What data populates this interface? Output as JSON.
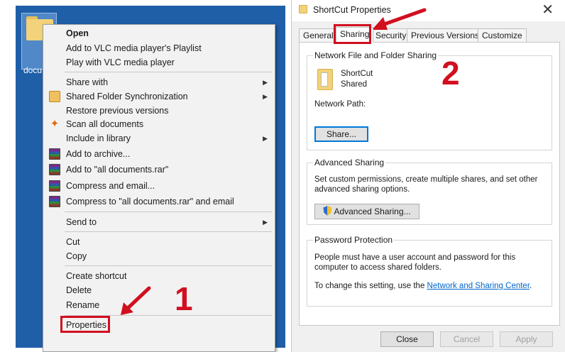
{
  "desktop": {
    "icon_label": "docu"
  },
  "context_menu": {
    "items": [
      {
        "label": "Open",
        "bold": true
      },
      {
        "label": "Add to VLC media player's Playlist"
      },
      {
        "label": "Play with VLC media player"
      },
      {
        "label": "Share with",
        "submenu": true
      },
      {
        "label": "Shared Folder Synchronization",
        "submenu": true,
        "icon": "sync-icon"
      },
      {
        "label": "Restore previous versions"
      },
      {
        "label": "Scan all documents",
        "icon": "scan-icon"
      },
      {
        "label": "Include in library",
        "submenu": true
      },
      {
        "label": "Add to archive...",
        "icon": "winrar-icon"
      },
      {
        "label": "Add to \"all documents.rar\"",
        "icon": "winrar-icon"
      },
      {
        "label": "Compress and email...",
        "icon": "winrar-icon"
      },
      {
        "label": "Compress to \"all documents.rar\" and email",
        "icon": "winrar-icon"
      },
      {
        "label": "Send to",
        "submenu": true
      },
      {
        "label": "Cut"
      },
      {
        "label": "Copy"
      },
      {
        "label": "Create shortcut"
      },
      {
        "label": "Delete"
      },
      {
        "label": "Rename"
      },
      {
        "label": "Properties"
      }
    ],
    "submenu_arrow": "▶"
  },
  "annotations": {
    "step1": "1",
    "step2": "2",
    "highlight_color": "#d10f1f"
  },
  "dialog": {
    "title": "ShortCut Properties",
    "close_glyph": "✕",
    "tabs": [
      "General",
      "Sharing",
      "Security",
      "Previous Versions",
      "Customize"
    ],
    "active_tab": "Sharing",
    "network_sharing": {
      "title": "Network File and Folder Sharing",
      "folder_name": "ShortCut",
      "folder_status": "Shared",
      "network_path_label": "Network Path:",
      "share_button": "Share..."
    },
    "advanced_sharing": {
      "title": "Advanced Sharing",
      "description_line1": "Set custom permissions, create multiple shares, and set other",
      "description_line2": "advanced sharing options.",
      "button": "Advanced Sharing..."
    },
    "password_protection": {
      "title": "Password Protection",
      "line1": "People must have a user account and password for this",
      "line2": "computer to access shared folders.",
      "line3_prefix": "To change this setting, use the ",
      "link": "Network and Sharing Center",
      "line3_suffix": "."
    },
    "buttons": {
      "close": "Close",
      "cancel": "Cancel",
      "apply": "Apply"
    }
  }
}
